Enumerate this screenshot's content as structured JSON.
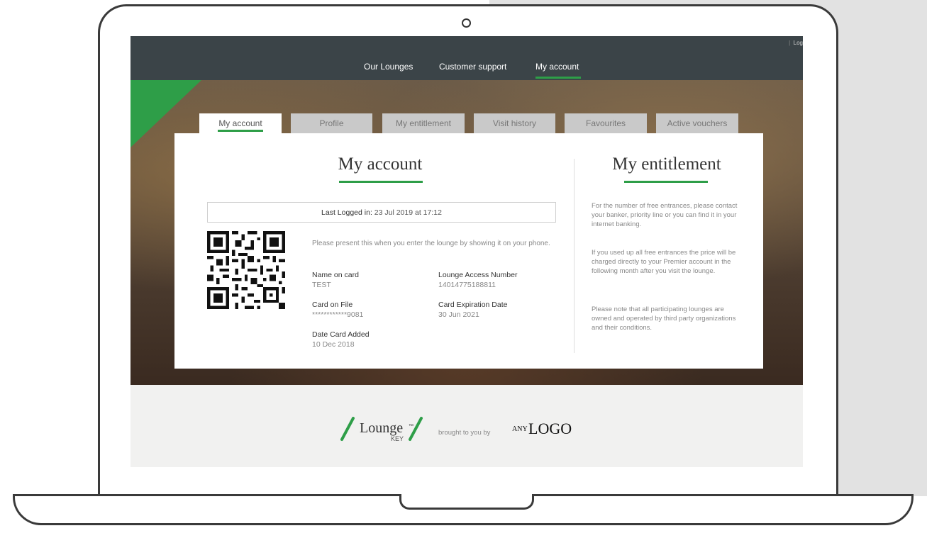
{
  "nav": {
    "items": [
      "Our Lounges",
      "Customer support",
      "My account"
    ],
    "logout_partial": "Log"
  },
  "tabs": [
    "My account",
    "Profile",
    "My entitlement",
    "Visit history",
    "Favourites",
    "Active vouchers"
  ],
  "account": {
    "title": "My account",
    "last_logged_label": "Last Logged in:",
    "last_logged_value": "23 Jul 2019 at 17:12",
    "present_text": "Please present this when you enter the lounge by showing it on your phone.",
    "fields": {
      "name_on_card_label": "Name on card",
      "name_on_card_value": "TEST",
      "lounge_access_label": "Lounge Access Number",
      "lounge_access_value": "14014775188811",
      "card_on_file_label": "Card on File",
      "card_on_file_value": "************9081",
      "card_exp_label": "Card Expiration Date",
      "card_exp_value": "30 Jun 2021",
      "date_added_label": "Date Card Added",
      "date_added_value": "10 Dec 2018"
    }
  },
  "entitlement": {
    "title": "My entitlement",
    "p1": "For the number of free entrances, please contact your banker, priority line or you can find it in your internet banking.",
    "p2": "If you used up all free entrances the price will be charged directly to your Premier account in the following month after you visit the lounge.",
    "p3": "Please note that all participating lounges are owned and operated by third party organizations and their conditions."
  },
  "footer": {
    "brand": "Lounge",
    "brand_sub": "KEY",
    "brand_tm": "™",
    "brought_by": "brought to you by",
    "partner_small": "ANY",
    "partner_big": "LOGO"
  },
  "colors": {
    "accent": "#2e9e48",
    "nav_bg": "#3b4448"
  }
}
